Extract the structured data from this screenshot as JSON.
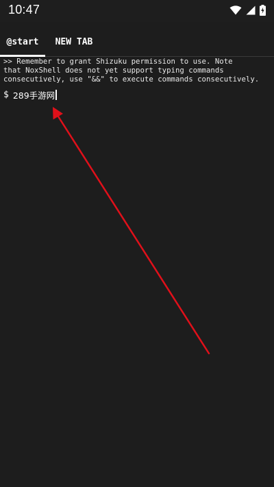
{
  "status_bar": {
    "time": "10:47",
    "icons": [
      "wifi-icon",
      "signal-icon",
      "battery-charging-icon"
    ]
  },
  "tabs": [
    {
      "label": "@start",
      "active": true
    },
    {
      "label": "NEW TAB",
      "active": false
    }
  ],
  "terminal": {
    "note": ">> Remember to grant Shizuku permission to use. Note\nthat NoxShell does not yet support typing commands\nconsecutively, use \"&&\" to execute commands consecutively.",
    "prompt_symbol": "$",
    "input_value": "289手游网"
  },
  "colors": {
    "background": "#1d1d1d",
    "text": "#ffffff",
    "annotation_arrow": "#e0101a"
  }
}
